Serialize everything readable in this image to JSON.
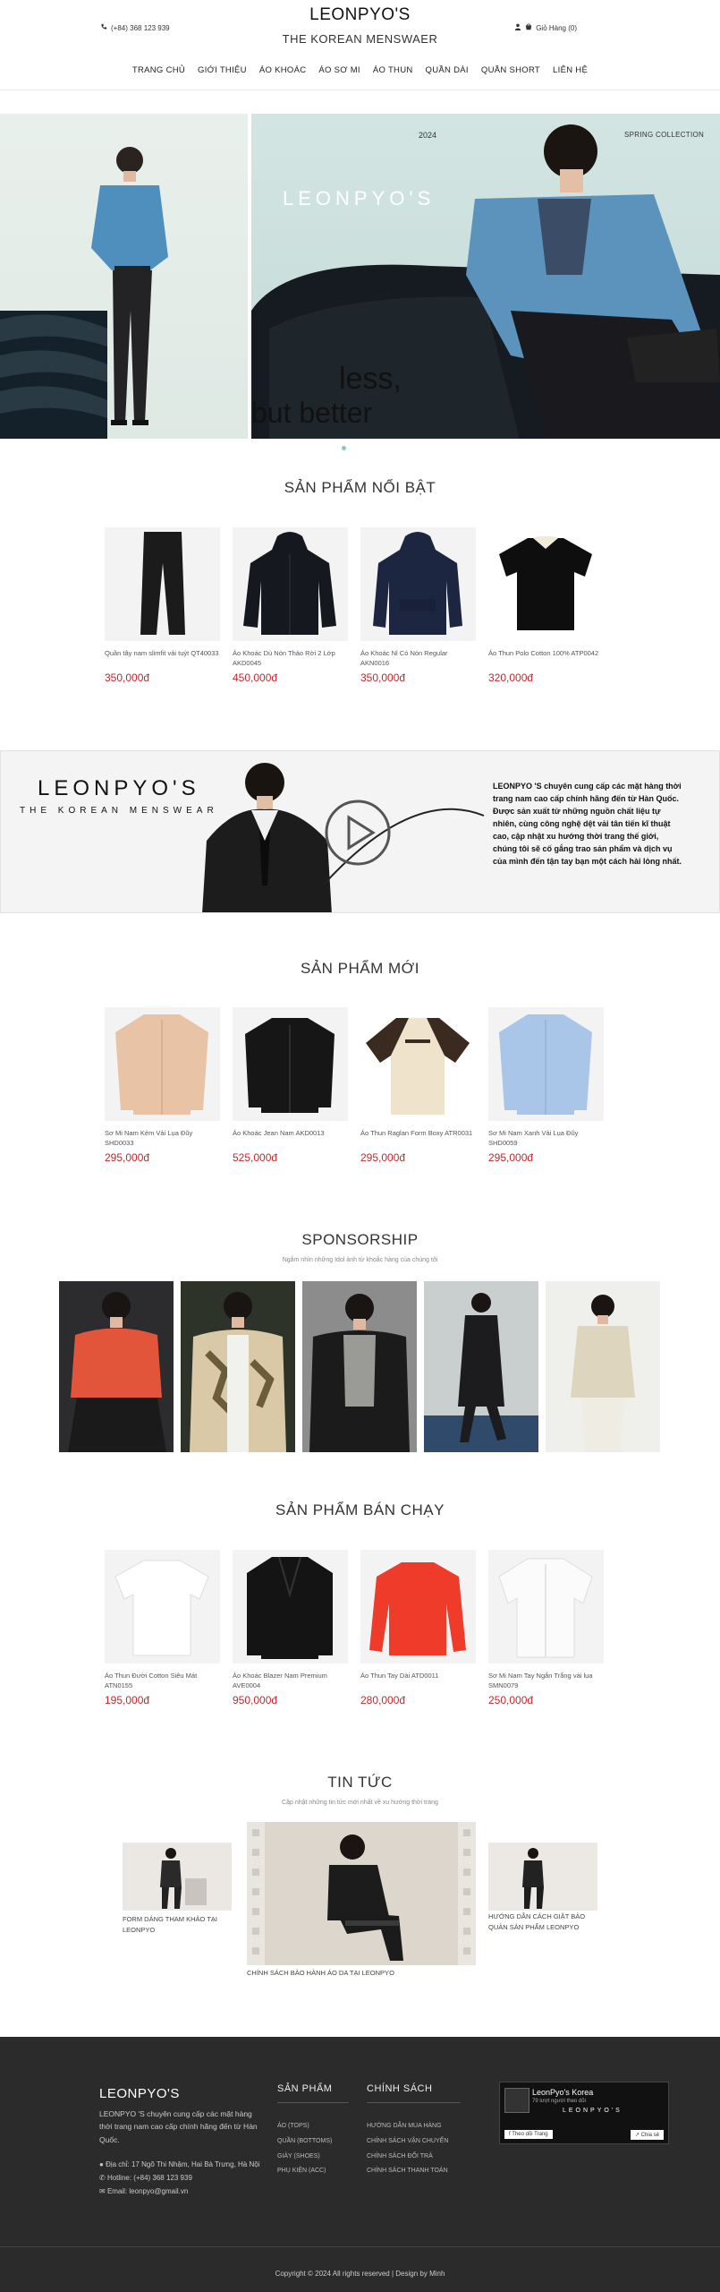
{
  "header": {
    "phone": "(+84) 368 123 939",
    "brand_title": "LEONPYO'S",
    "brand_sub": "THE KOREAN MENSWAER",
    "cart": "Giỏ Hàng (0)"
  },
  "nav": [
    "TRANG CHỦ",
    "GIỚI THIỆU",
    "ÁO KHOÁC",
    "ÁO SƠ MI",
    "ÁO THUN",
    "QUẦN DÀI",
    "QUẦN SHORT",
    "LIÊN HỆ"
  ],
  "hero": {
    "year": "2024",
    "season": "SPRING COLLECTION",
    "brand": "LEONPYO'S",
    "line1": "less,",
    "line2": "but better"
  },
  "featured": {
    "title": "SẢN PHẨM NỔI BẬT",
    "items": [
      {
        "name": "Quần tây nam slimfit vải tuýt QT40033",
        "price": "350,000đ",
        "color": "#1b1b1b",
        "icon": "pants-icon"
      },
      {
        "name": "Áo Khoác Dù Nón Thảo Rời 2 Lớp AKD0045",
        "price": "450,000đ",
        "color": "#15181f",
        "icon": "hoodie-jacket-icon"
      },
      {
        "name": "Áo Khoác Nỉ Có Nón Regular AKN0016",
        "price": "350,000đ",
        "color": "#1d2640",
        "icon": "hoodie-icon"
      },
      {
        "name": "Áo Thun Polo Cotton 100% ATP0042",
        "price": "320,000đ",
        "color": "#0e0e0e",
        "icon": "polo-icon"
      }
    ]
  },
  "banner": {
    "logo": "LEONPYO'S",
    "tagline": "THE KOREAN MENSWEAR",
    "text": "LEONPYO 'S chuyên cung cấp các mặt hàng thời trang nam cao cấp chính hãng đến từ Hàn Quốc. Được sản xuất từ những nguồn chất liệu tự nhiên, cùng công nghệ dệt vải tân tiến kĩ thuật cao, cập nhật xu hướng thời trang thế giới, chúng tôi sẽ cố gắng trao sản phẩm và dịch vụ của mình đến tận tay bạn một cách hài lòng nhất."
  },
  "new_products": {
    "title": "SẢN PHẨM MỚI",
    "items": [
      {
        "name": "Sơ Mi Nam Kẻm Vải Lụa Đũy SHD0033",
        "price": "295,000đ",
        "color": "#e9c3a6",
        "icon": "shirt-icon"
      },
      {
        "name": "Áo Khoác Jean Nam AKD0013",
        "price": "525,000đ",
        "color": "#161616",
        "icon": "denim-jacket-icon"
      },
      {
        "name": "Áo Thun Raglan Form Boxy ATR0031",
        "price": "295,000đ",
        "color": "#efe3cc",
        "icon": "raglan-tee-icon"
      },
      {
        "name": "Sơ Mi Nam Xanh Vải Lụa Đũy SHD0059",
        "price": "295,000đ",
        "color": "#a9c6e8",
        "icon": "shirt-icon"
      }
    ]
  },
  "sponsorship": {
    "title": "SPONSORSHIP",
    "subtitle": "Ngắm nhìn những Idol ảnh từ khoắc hàng của chúng tôi"
  },
  "bestsellers": {
    "title": "SẢN PHẨM BÁN CHẠY",
    "items": [
      {
        "name": "Áo Thun Đười Cotton Siêu Mát ATN0155",
        "price": "195,000đ",
        "color": "#f4f4f4",
        "icon": "tshirt-icon"
      },
      {
        "name": "Áo Khoác Blazer Nam Premium AVE0004",
        "price": "950,000đ",
        "color": "#141414",
        "icon": "blazer-icon"
      },
      {
        "name": "Áo Thun Tay Dài ATD0011",
        "price": "280,000đ",
        "color": "#ef3b2a",
        "icon": "sweater-icon"
      },
      {
        "name": "Sơ Mi Nam Tay Ngắn Trắng vải lụa SMN0079",
        "price": "250,000đ",
        "color": "#f7f7f7",
        "icon": "shirt-icon"
      }
    ]
  },
  "news": {
    "title": "TIN TỨC",
    "subtitle": "Cập nhật những tin tức mới nhất về xu hướng thời trang",
    "left_caption": "FORM DÁNG THAM KHẢO TẠI LEONPYO",
    "center_caption": "CHÍNH SÁCH BẢO HÀNH ÁO DA TẠI LEONPYO",
    "right_caption": "HƯỚNG DẪN CÁCH GIẶT BẢO QUẢN SẢN PHẨM LEONPYO"
  },
  "footer": {
    "brand": "LEONPYO'S",
    "desc": "LEONPYO 'S chuyên cung cấp các mặt hàng thời trang nam cao cấp chính hãng đến từ Hàn Quốc.",
    "address": "Địa chỉ: 17 Ngõ Thi Nhậm, Hai Bà Trưng, Hà Nội",
    "hotline": "Hotline: (+84) 368 123 939",
    "email": "Email: leonpyo@gmail.vn",
    "col1_title": "SẢN PHẨM",
    "col1_links": [
      "ÁO (TOPS)",
      "QUẦN (BOTTOMS)",
      "GIÀY (SHOES)",
      "PHỤ KIỆN (ACC)"
    ],
    "col2_title": "CHÍNH SÁCH",
    "col2_links": [
      "HƯỚNG DẪN MUA HÀNG",
      "CHÍNH SÁCH VẬN CHUYỂN",
      "CHÍNH SÁCH ĐỔI TRẢ",
      "CHÍNH SÁCH THANH TOÁN"
    ],
    "fb_name": "LeonPyo's Korea",
    "fb_likes": "79 lượt người theo dõi",
    "fb_brand": "LEONPYO'S",
    "fb_follow": "Theo dõi Trang",
    "fb_share": "Chia sẻ",
    "copyright": "Copyright © 2024 All rights reserved | Design by Minh"
  }
}
